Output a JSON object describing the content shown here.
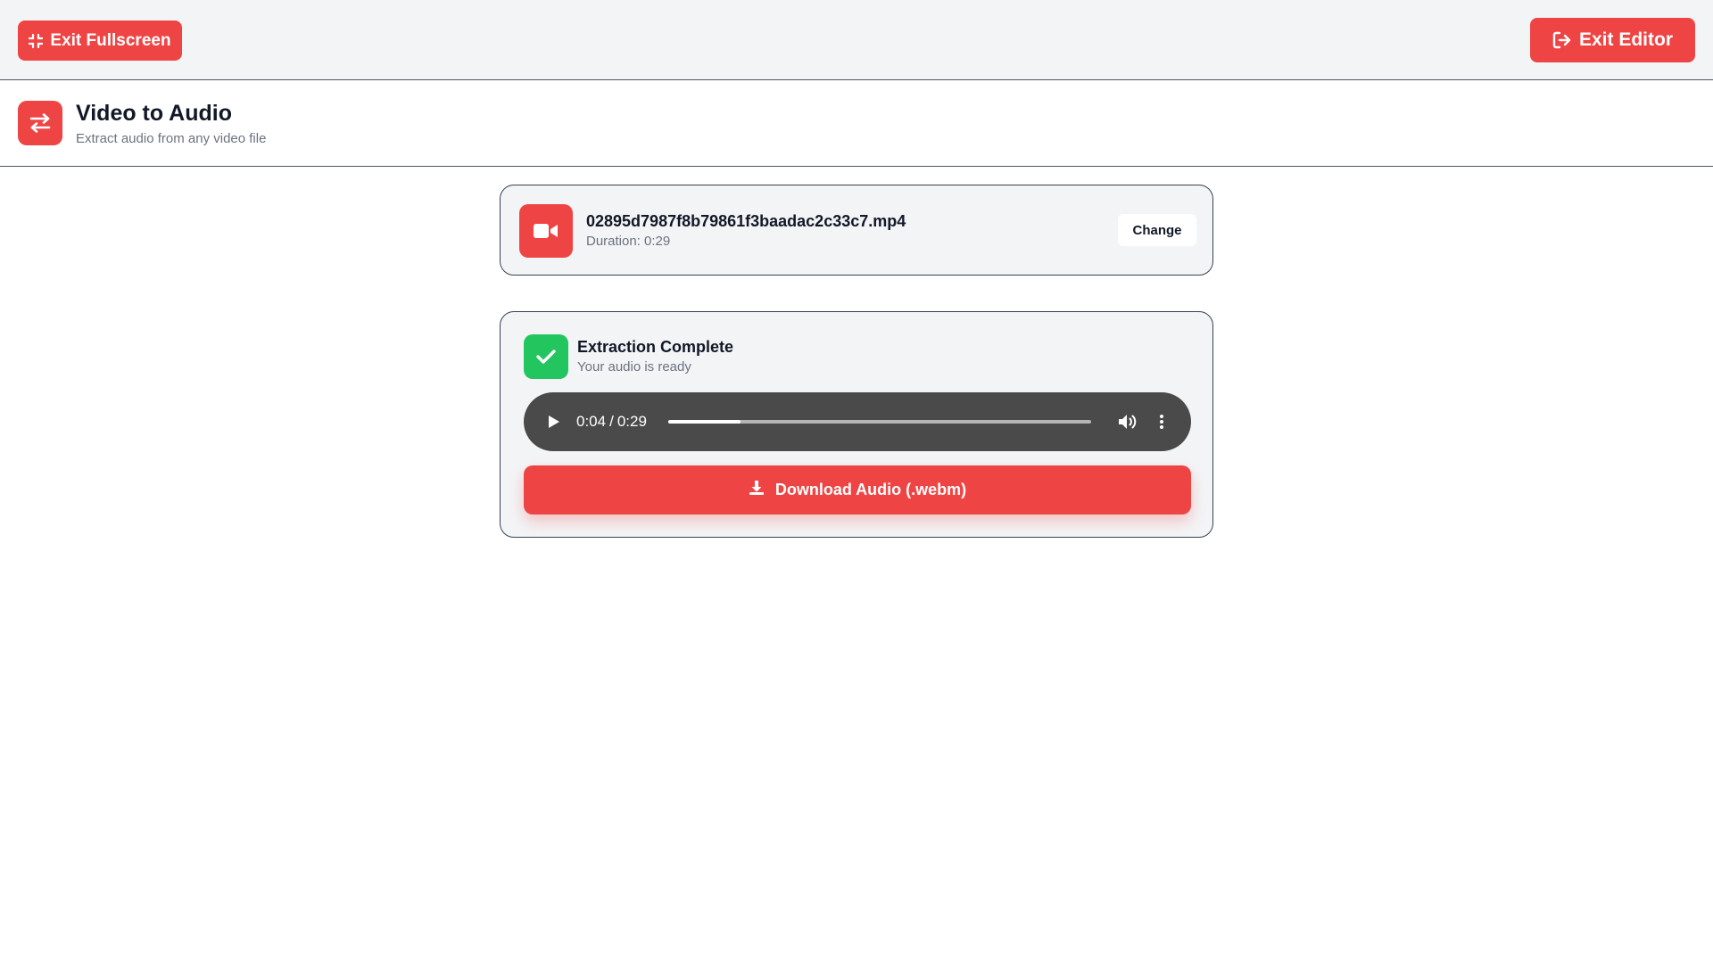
{
  "topbar": {
    "exit_fullscreen_label": "Exit Fullscreen",
    "exit_editor_label": "Exit Editor"
  },
  "header": {
    "title": "Video to Audio",
    "subtitle": "Extract audio from any video file",
    "icon": "swap-arrows-icon"
  },
  "file": {
    "name": "02895d7987f8b79861f3baadac2c33c7.mp4",
    "duration_text": "Duration: 0:29",
    "change_label": "Change",
    "icon": "video-camera-icon"
  },
  "result": {
    "title": "Extraction Complete",
    "subtitle": "Your audio is ready",
    "icon": "check-icon"
  },
  "player": {
    "current_time": "0:04",
    "separator": "/",
    "total_time": "0:29",
    "progress_percent": 17
  },
  "download": {
    "label": "Download Audio (.webm)",
    "icon": "download-icon"
  },
  "colors": {
    "accent": "#ef4444",
    "success": "#22c55e",
    "player_bg": "#4a4a4a",
    "card_bg": "#f3f4f6"
  }
}
